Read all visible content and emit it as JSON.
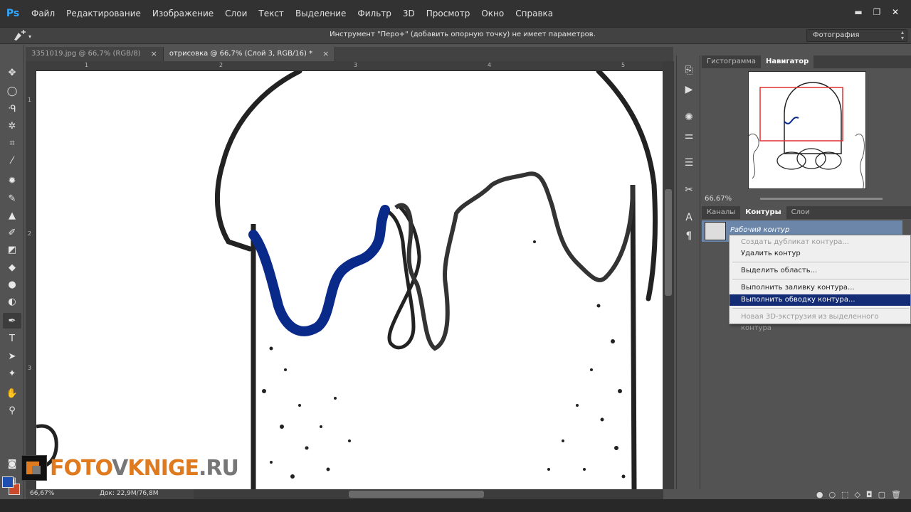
{
  "app": {
    "logo": "Ps"
  },
  "menu": [
    "Файл",
    "Редактирование",
    "Изображение",
    "Слои",
    "Текст",
    "Выделение",
    "Фильтр",
    "3D",
    "Просмотр",
    "Окно",
    "Справка"
  ],
  "window_controls": {
    "minimize": "▬",
    "restore": "❐",
    "close": "✕"
  },
  "options": {
    "message": "Инструмент \"Перо+\" (добавить опорную точку) не имеет параметров.",
    "workspace": "Фотография"
  },
  "tabs": [
    {
      "label": "3351019.jpg @ 66,7% (RGB/8)",
      "close": "×"
    },
    {
      "label": "отрисовка @ 66,7% (Слой 3, RGB/16) *",
      "close": "×"
    }
  ],
  "ruler_top": [
    "1",
    "2",
    "3",
    "4",
    "5"
  ],
  "ruler_left": [
    "1",
    "2",
    "3"
  ],
  "status": {
    "zoom": "66,67%",
    "doc": "Док: 22,9M/76,8M"
  },
  "watermark": {
    "part1": "FOTO",
    "part2": "V",
    "part3": "KNIGE",
    "part4": ".RU"
  },
  "navigator": {
    "tabs": [
      "Гистограмма",
      "Навигатор"
    ],
    "zoom": "66,67%"
  },
  "paths_panel": {
    "tabs": [
      "Каналы",
      "Контуры",
      "Слои"
    ],
    "path_name": "Рабочий контур"
  },
  "context_menu": [
    {
      "label": "Создать дубликат контура...",
      "state": "disabled"
    },
    {
      "label": "Удалить контур",
      "state": "normal"
    },
    {
      "label": "Выделить область...",
      "state": "normal"
    },
    {
      "label": "Выполнить заливку контура...",
      "state": "normal"
    },
    {
      "label": "Выполнить обводку контура...",
      "state": "selected"
    },
    {
      "label": "Новая 3D-экструзия из выделенного контура",
      "state": "disabled"
    }
  ],
  "colors": {
    "foreground": "#1e4fb0",
    "background": "#c94b2b",
    "stroke": "#0a2a8a",
    "menu_highlight": "#132c75"
  },
  "icons": {
    "tools": [
      "move-icon",
      "ellipse-marquee-icon",
      "lasso-icon",
      "magic-wand-icon",
      "crop-icon",
      "eyedropper-icon",
      "healing-icon",
      "brush-icon",
      "stamp-icon",
      "history-brush-icon",
      "eraser-icon",
      "paint-bucket-icon",
      "blur-icon",
      "dodge-icon",
      "pen-icon",
      "type-icon",
      "path-select-icon",
      "shape-icon",
      "hand-icon",
      "zoom-icon"
    ],
    "panels": [
      "history-icon",
      "actions-icon",
      "brushes-icon",
      "adjustments-icon",
      "layer-comps-icon",
      "tools-presets-icon",
      "character-icon",
      "paragraph-icon"
    ]
  }
}
